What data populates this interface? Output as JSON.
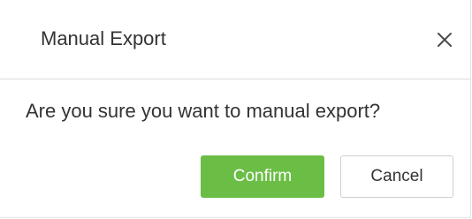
{
  "dialog": {
    "title": "Manual Export",
    "close_icon": "close-icon",
    "message": "Are you sure you want to manual export?",
    "confirm_label": "Confirm",
    "cancel_label": "Cancel"
  },
  "colors": {
    "confirm_background": "#6bbe45",
    "confirm_text": "#ffffff",
    "text": "#333333",
    "divider": "#dcdcdc"
  }
}
